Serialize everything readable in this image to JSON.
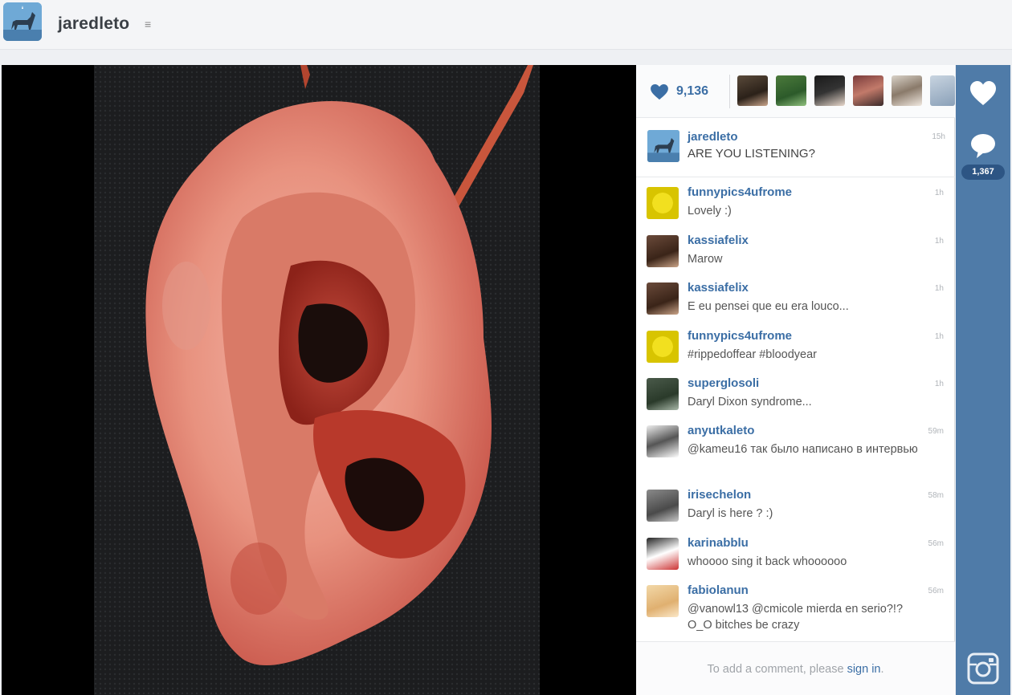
{
  "header": {
    "username": "jaredleto",
    "menu_glyph": "≡",
    "avatar_icon": "unicorn-avatar-icon"
  },
  "post": {
    "photo_icon": "bloody-ear-photo",
    "likes": {
      "count": "9,136",
      "icon": "heart-icon"
    },
    "caption": {
      "user": "jaredleto",
      "text": "ARE YOU LISTENING?",
      "time": "15h"
    },
    "comments": [
      {
        "user": "funnypics4ufrome",
        "text": "Lovely :)",
        "time": "1h"
      },
      {
        "user": "kassiafelix",
        "text": "Marow",
        "time": "1h"
      },
      {
        "user": "kassiafelix",
        "text": "E eu pensei que eu era louco...",
        "time": "1h"
      },
      {
        "user": "funnypics4ufrome",
        "text": "#rippedoffear #bloodyear",
        "time": "1h"
      },
      {
        "user": "superglosoli",
        "text": "Daryl Dixon syndrome...",
        "time": "1h"
      },
      {
        "user": "anyutkaleto",
        "text": "@kameu16 так было написано в интервью",
        "time": "59m"
      },
      {
        "user": "irisechelon",
        "text": "Daryl is here ? :)",
        "time": "58m"
      },
      {
        "user": "karinabblu",
        "text": "whoooo sing it back whoooooo",
        "time": "56m"
      },
      {
        "user": "fabiolanun",
        "text": "@vanowl13 @cmicole mierda en serio?!? O_O bitches be crazy",
        "time": "56m"
      }
    ],
    "add_comment": {
      "prefix": "To add a comment, please ",
      "link": "sign in",
      "suffix": "."
    }
  },
  "rail": {
    "like_icon": "heart-icon",
    "comment_icon": "speech-bubble-icon",
    "comment_count": "1,367",
    "logo_icon": "instagram-logo-icon"
  },
  "colors": {
    "accent": "#3b6ea5",
    "rail": "#4f7ba8",
    "badge": "#2d5584"
  }
}
